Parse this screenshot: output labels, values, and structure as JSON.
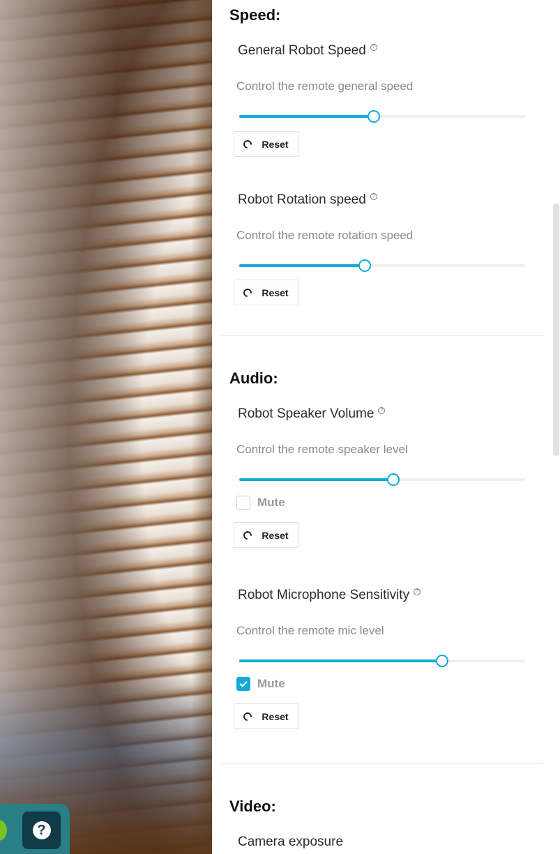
{
  "help": {
    "icon": "question-icon",
    "glyph": "?"
  },
  "sections": {
    "speed": {
      "title": "Speed:",
      "general": {
        "label": "General Robot Speed",
        "desc": "Control the remote general speed",
        "value": 0.47,
        "reset_label": "Reset"
      },
      "rotation": {
        "label": "Robot Rotation speed",
        "desc": "Control the remote rotation speed",
        "value": 0.44,
        "reset_label": "Reset"
      }
    },
    "audio": {
      "title": "Audio:",
      "speaker": {
        "label": "Robot Speaker Volume",
        "desc": "Control the remote speaker level",
        "value": 0.54,
        "mute_label": "Mute",
        "muted": false,
        "reset_label": "Reset"
      },
      "mic": {
        "label": "Robot Microphone Sensitivity",
        "desc": "Control the remote mic level",
        "value": 0.71,
        "mute_label": "Mute",
        "muted": true,
        "reset_label": "Reset"
      }
    },
    "video": {
      "title": "Video:",
      "exposure": {
        "label": "Camera exposure"
      }
    }
  },
  "colors": {
    "accent": "#12aadb",
    "help_bg": "#113c47",
    "dock_bg": "#2a7f86",
    "status_green": "#7cc21f"
  }
}
